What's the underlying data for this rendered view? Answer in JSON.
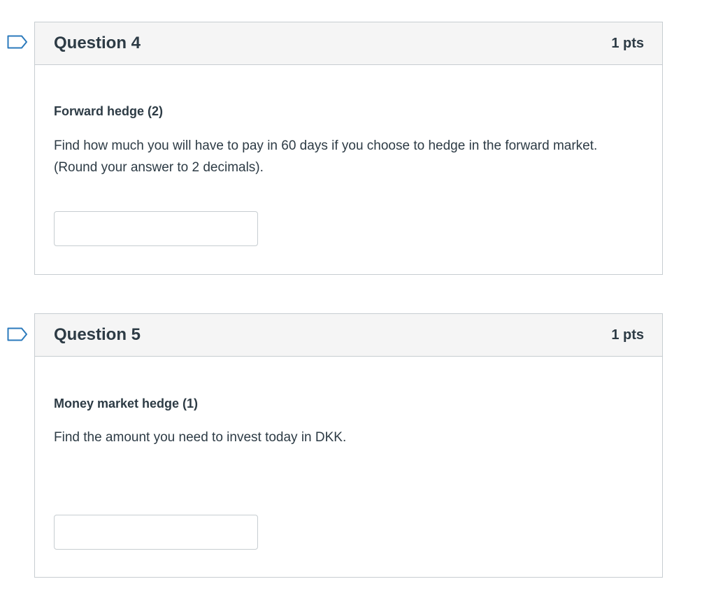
{
  "questions": [
    {
      "title": "Question 4",
      "points": "1 pts",
      "subtitle": "Forward hedge (2)",
      "text": "Find how much you will have to pay in 60 days if you choose to hedge in the forward market. (Round your answer to 2 decimals).",
      "answer_value": "",
      "flag_icon": "bookmark-flag-icon"
    },
    {
      "title": "Question 5",
      "points": "1 pts",
      "subtitle": "Money market hedge (1)",
      "text": "Find the amount you need to invest today in DKK.",
      "answer_value": "",
      "flag_icon": "bookmark-flag-icon"
    }
  ],
  "colors": {
    "flag": "#2b7abc",
    "border": "#c7cdd1",
    "header_bg": "#f5f5f5",
    "text": "#2d3b45"
  }
}
